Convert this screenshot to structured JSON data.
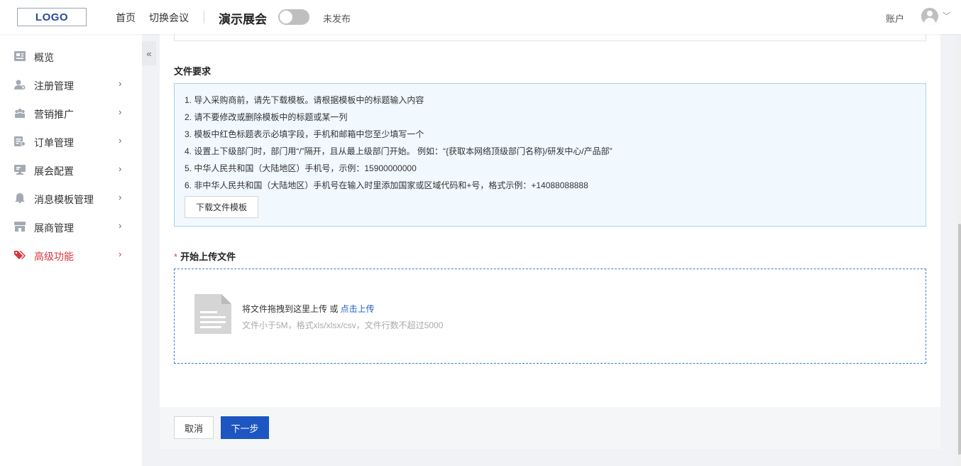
{
  "header": {
    "logo": "LOGO",
    "nav": [
      "首页",
      "切换会议"
    ],
    "event_title": "演示展会",
    "publish_status": "未发布",
    "account_label": "账户"
  },
  "sidebar": {
    "collapse": "«",
    "items": [
      {
        "label": "概览",
        "icon": "overview-icon",
        "has_chevron": false
      },
      {
        "label": "注册管理",
        "icon": "user-register-icon",
        "has_chevron": true
      },
      {
        "label": "营销推广",
        "icon": "people-icon",
        "has_chevron": true
      },
      {
        "label": "订单管理",
        "icon": "order-icon",
        "has_chevron": true
      },
      {
        "label": "展会配置",
        "icon": "monitor-icon",
        "has_chevron": true
      },
      {
        "label": "消息模板管理",
        "icon": "bell-icon",
        "has_chevron": true
      },
      {
        "label": "展商管理",
        "icon": "store-icon",
        "has_chevron": true
      },
      {
        "label": "高级功能",
        "icon": "tags-icon",
        "has_chevron": true,
        "active": true
      }
    ],
    "chevron": "›"
  },
  "main": {
    "requirements_title": "文件要求",
    "requirements": [
      "1. 导入采购商前，请先下载模板。请根据模板中的标题输入内容",
      "2. 请不要修改或删除模板中的标题或某一列",
      "3. 模板中红色标题表示必填字段，手机和邮箱中您至少填写一个",
      "4. 设置上下级部门时，部门用“/”隔开，且从最上级部门开始。 例如：“{获取本网络顶级部门名称}/研发中心/产品部”",
      "5. 中华人民共和国（大陆地区）手机号，示例：15900000000",
      "6. 非中华人民共和国（大陆地区）手机号在输入时里添加国家或区域代码和+号，格式示例：+14088088888"
    ],
    "download_label": "下载文件模板",
    "upload_required_mark": "*",
    "upload_title": "开始上传文件",
    "drop_text": "将文件拖拽到这里上传 或 ",
    "drop_link": "点击上传",
    "drop_hint": "文件小于5M，格式xls/xlsx/csv，文件行数不超过5000"
  },
  "footer": {
    "cancel_label": "取消",
    "next_label": "下一步"
  },
  "colors": {
    "accent": "#1d56c1",
    "active_menu": "#d9363e",
    "info_bg": "#f1f8fe",
    "info_border": "#a8d4f2"
  }
}
